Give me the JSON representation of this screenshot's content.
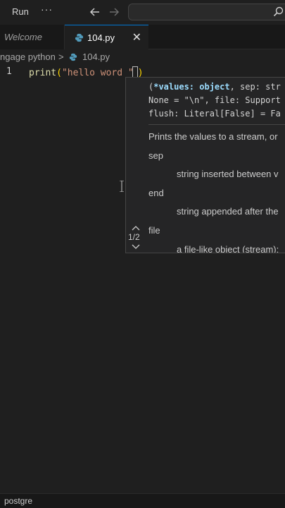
{
  "titlebar": {
    "run_label": "Run",
    "more_label": "···"
  },
  "tabs": [
    {
      "label": "Welcome",
      "active": false
    },
    {
      "label": "104.py",
      "active": true,
      "close": "✕"
    }
  ],
  "breadcrumb": {
    "folder": "ngage python",
    "separator": ">",
    "file": "104.py"
  },
  "editor": {
    "line_number": "1",
    "code": {
      "func": "print",
      "open_paren": "(",
      "string": "\"hello word \"",
      "close_paren": ")"
    }
  },
  "signature_help": {
    "line1_paren": "(",
    "line1_param": "*values: object",
    "line1_rest": ", sep: str",
    "line2": "None = \"\\n\", file: Support",
    "line3": "flush: Literal[False] = Fa",
    "description": "Prints the values to a stream, or",
    "params": [
      {
        "name": "sep",
        "desc": "string inserted between v"
      },
      {
        "name": "end",
        "desc": "string appended after the"
      },
      {
        "name": "file",
        "desc": "a file-like object (stream);"
      }
    ],
    "overload": "1/2"
  },
  "statusbar": {
    "text": "postgre"
  },
  "colors": {
    "accent": "#0078d4",
    "string": "#ce9178",
    "function": "#dcdcaa",
    "bracket": "#ffd700",
    "param": "#9cdcfe"
  }
}
